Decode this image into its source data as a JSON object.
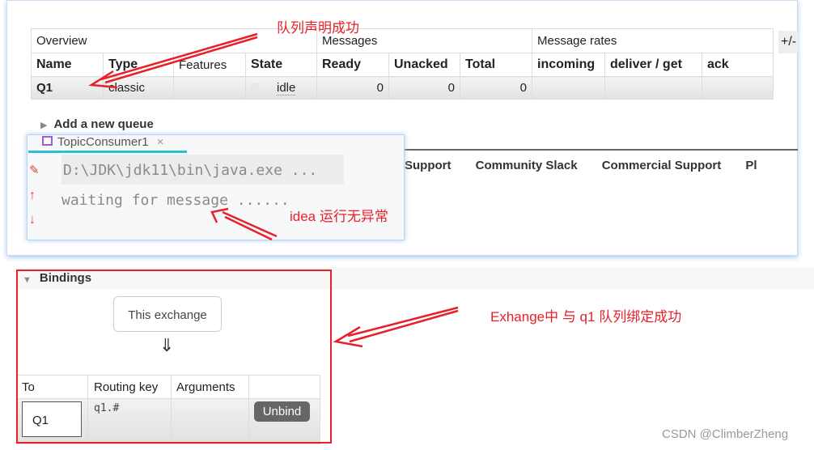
{
  "queues": {
    "group_headers": [
      "Overview",
      "Messages",
      "Message rates"
    ],
    "columns": [
      "Name",
      "Type",
      "Features",
      "State",
      "Ready",
      "Unacked",
      "Total",
      "incoming",
      "deliver / get",
      "ack"
    ],
    "plus_minus": "+/-",
    "rows": [
      {
        "name": "Q1",
        "type": "classic",
        "features": "",
        "state": "idle",
        "ready": "0",
        "unacked": "0",
        "total": "0",
        "incoming": "",
        "deliver_get": "",
        "ack": ""
      }
    ],
    "add_queue": "Add a new queue"
  },
  "footer_links": [
    "Support",
    "Community Slack",
    "Commercial Support",
    "Pl"
  ],
  "idea": {
    "tab": "TopicConsumer1",
    "close": "×",
    "lines": [
      "D:\\JDK\\jdk11\\bin\\java.exe ...",
      "waiting for message ......"
    ]
  },
  "bindings": {
    "title": "Bindings",
    "this_exchange": "This exchange",
    "arrow": "⇓",
    "columns": [
      "To",
      "Routing key",
      "Arguments",
      ""
    ],
    "rows": [
      {
        "to": "Q1",
        "routing_key": "q1.#",
        "arguments": "",
        "action": "Unbind"
      }
    ]
  },
  "annotations": {
    "queue_declared": "队列声明成功",
    "idea_ok": "idea 运行无异常",
    "binding_ok": "Exhange中 与 q1 队列绑定成功",
    "annotation_color": "#e8202a"
  },
  "watermark": "CSDN @ClimberZheng"
}
